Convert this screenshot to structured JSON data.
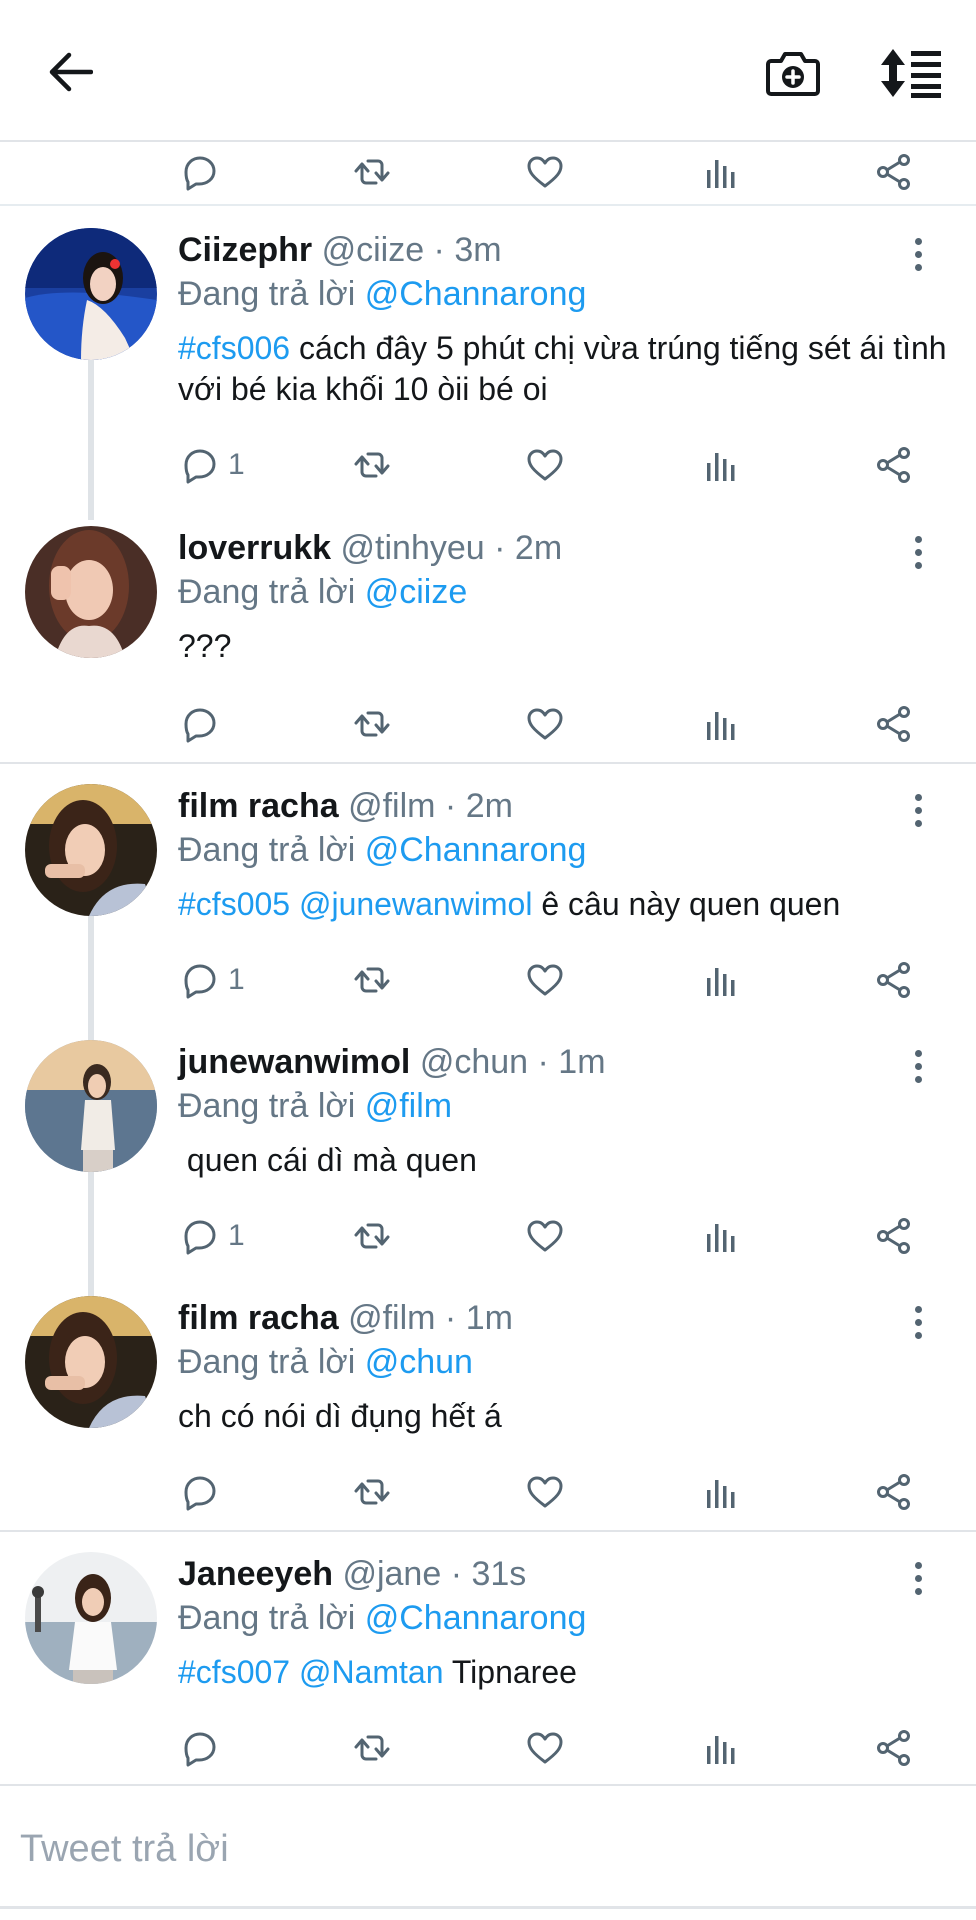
{
  "header": {
    "back_icon": "arrow-left-icon",
    "camera_icon": "camera-plus-icon",
    "sort_icon": "sort-list-icon"
  },
  "tweets": [
    {
      "name": "Ciizephr",
      "handle": "@ciize",
      "time": "3m",
      "replying_prefix": "Đang trả lời",
      "replying_to": "@Channarong",
      "text_parts": [
        {
          "t": "#cfs006",
          "link": true
        },
        {
          "t": " cách đây 5 phút chị vừa trúng tiếng sét ái tình với bé kia khối 10 òii bé oi",
          "link": false
        }
      ],
      "reply_count": "1"
    },
    {
      "name": "loverrukk",
      "handle": "@tinhyeu",
      "time": "2m",
      "replying_prefix": "Đang trả lời",
      "replying_to": "@ciize",
      "text_parts": [
        {
          "t": "???",
          "link": false
        }
      ],
      "reply_count": ""
    },
    {
      "name": "film racha",
      "handle": "@film",
      "time": "2m",
      "replying_prefix": "Đang trả lời",
      "replying_to": "@Channarong",
      "text_parts": [
        {
          "t": "#cfs005",
          "link": true
        },
        {
          "t": " ",
          "link": false
        },
        {
          "t": "@junewanwimol",
          "link": true
        },
        {
          "t": " ê câu này quen quen",
          "link": false
        }
      ],
      "reply_count": "1"
    },
    {
      "name": "junewanwimol",
      "handle": "@chun",
      "time": "1m",
      "replying_prefix": "Đang trả lời",
      "replying_to": "@film",
      "text_parts": [
        {
          "t": " quen cái dì mà quen",
          "link": false
        }
      ],
      "reply_count": "1"
    },
    {
      "name": "film racha",
      "handle": "@film",
      "time": "1m",
      "replying_prefix": "Đang trả lời",
      "replying_to": "@chun",
      "text_parts": [
        {
          "t": "ch có nói dì đụng hết á",
          "link": false
        }
      ],
      "reply_count": ""
    },
    {
      "name": "Janeeyeh",
      "handle": "@jane",
      "time": "31s",
      "replying_prefix": "Đang trả lời",
      "replying_to": "@Channarong",
      "text_parts": [
        {
          "t": "#cfs007",
          "link": true
        },
        {
          "t": " ",
          "link": false
        },
        {
          "t": "@Namtan",
          "link": true
        },
        {
          "t": " Tipnaree",
          "link": false
        }
      ],
      "reply_count": ""
    }
  ],
  "reply_bar": {
    "placeholder": "Tweet trả lời"
  },
  "colors": {
    "link": "#1d9bf0",
    "muted": "#657786",
    "icon": "#536471",
    "divider": "#e1e4e8"
  }
}
